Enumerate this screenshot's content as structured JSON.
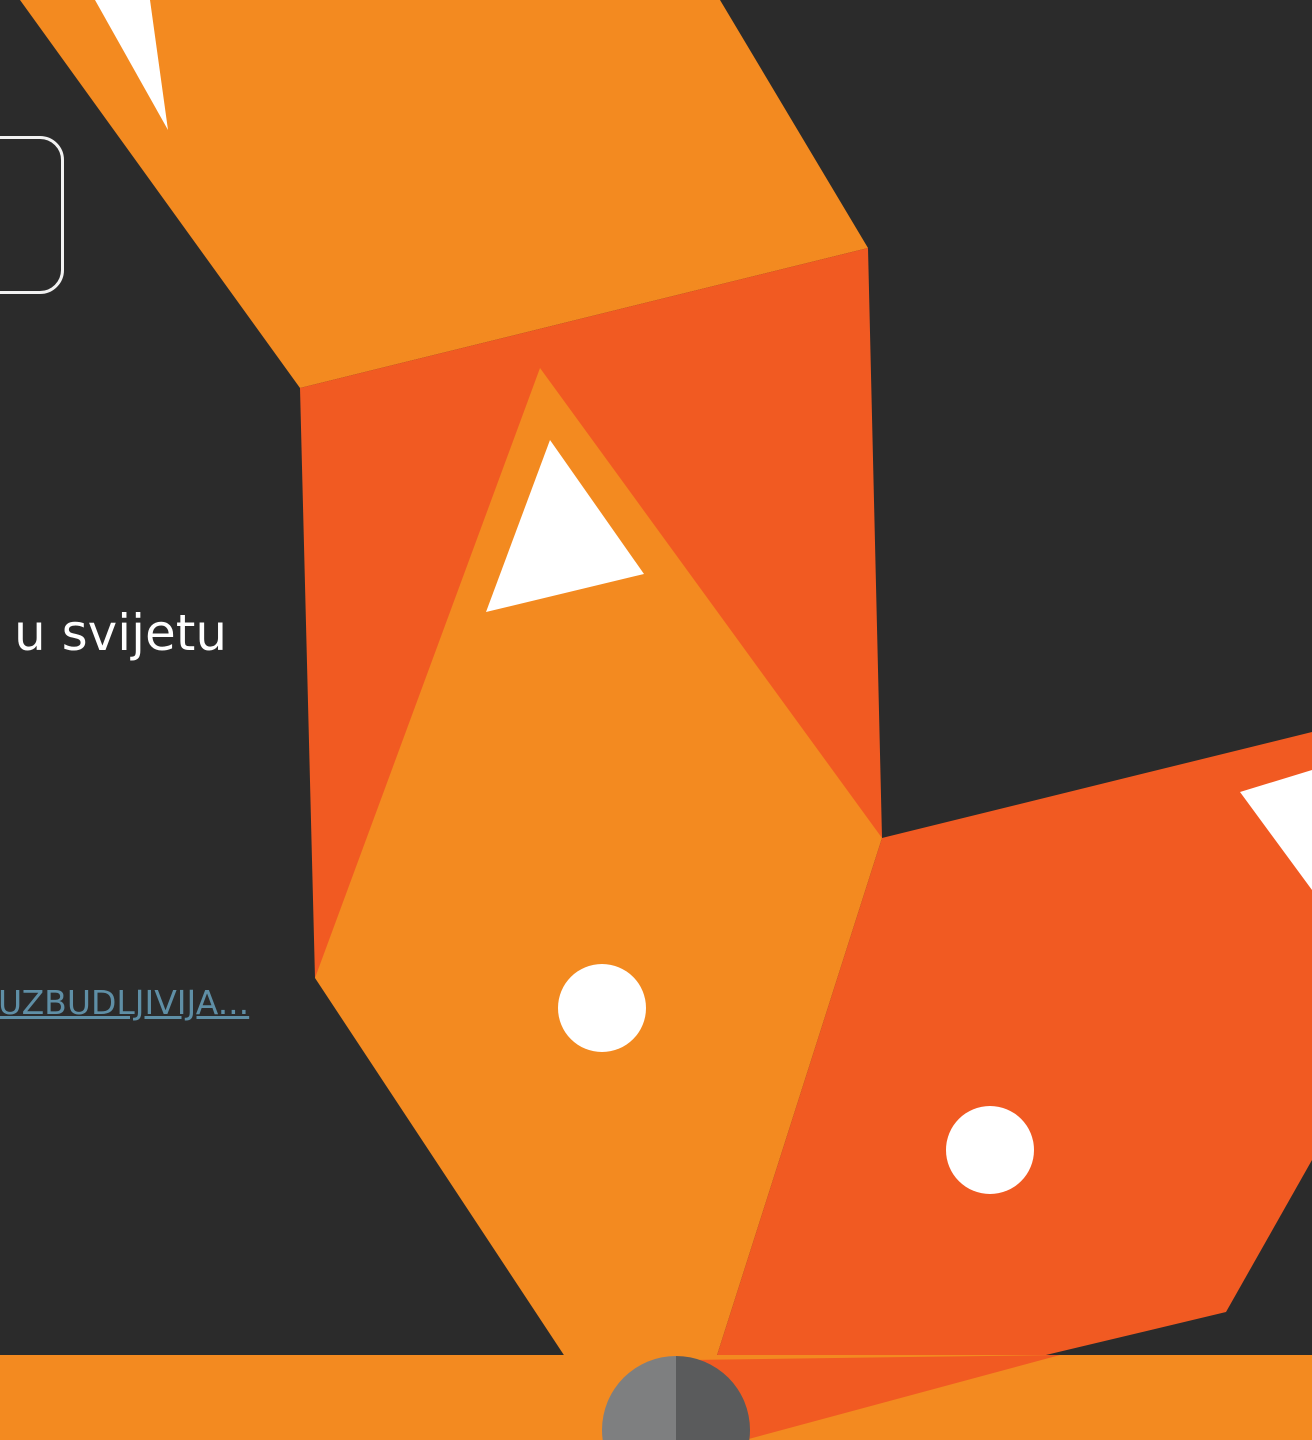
{
  "hero": {
    "headline_text": "u svijetu",
    "link_text": "UZBUDLJIVIJA..."
  },
  "illustration": {
    "icon": "geometric-fox-icon",
    "colors": {
      "background": "#2b2b2b",
      "orange_light": "#f38a20",
      "orange_dark": "#f15a22",
      "white": "#ffffff"
    }
  },
  "footer": {
    "bar_color": "#f38a20",
    "scroll_button_icon": "scroll-top-icon"
  }
}
